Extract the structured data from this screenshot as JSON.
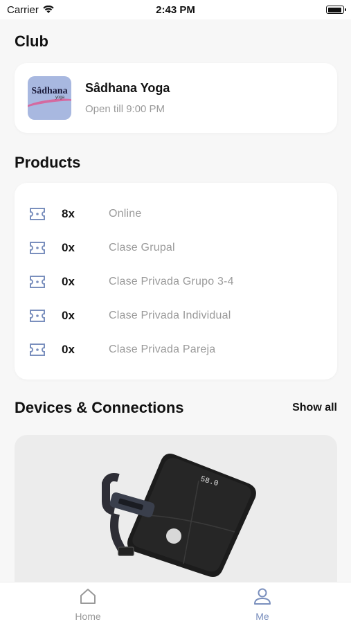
{
  "status_bar": {
    "carrier": "Carrier",
    "time": "2:43 PM"
  },
  "club": {
    "section_title": "Club",
    "logo_text": "Sâdhana",
    "logo_subtext": "yoga",
    "name": "Sâdhana Yoga",
    "hours": "Open till 9:00 PM"
  },
  "products": {
    "section_title": "Products",
    "items": [
      {
        "qty": "8x",
        "name": "Online"
      },
      {
        "qty": "0x",
        "name": "Clase Grupal"
      },
      {
        "qty": "0x",
        "name": "Clase Privada Grupo 3-4"
      },
      {
        "qty": "0x",
        "name": "Clase Privada Individual"
      },
      {
        "qty": "0x",
        "name": "Clase Privada Pareja"
      }
    ]
  },
  "devices": {
    "section_title": "Devices & Connections",
    "show_all_label": "Show all",
    "scale_display": "58.0"
  },
  "tabbar": {
    "home_label": "Home",
    "me_label": "Me"
  },
  "colors": {
    "accent": "#7a8fbd",
    "muted": "#9a9a9a",
    "background": "#f7f7f7"
  },
  "icons": [
    "wifi-icon",
    "battery-icon",
    "ticket-icon",
    "home-icon",
    "person-icon"
  ]
}
